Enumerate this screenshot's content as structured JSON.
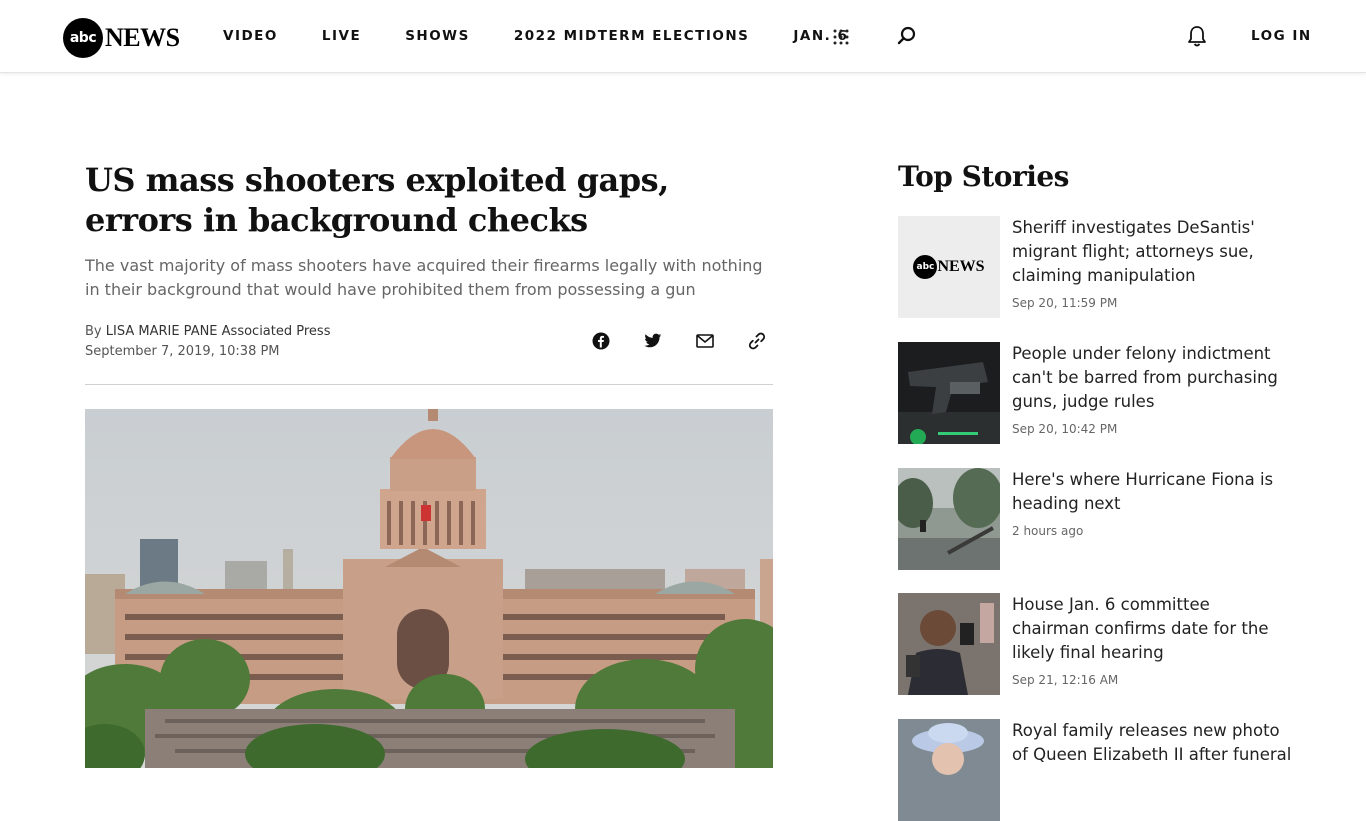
{
  "header": {
    "logo_abc": "abc",
    "logo_news": "NEWS",
    "nav": [
      "VIDEO",
      "LIVE",
      "SHOWS",
      "2022 MIDTERM ELECTIONS",
      "JAN. 6"
    ],
    "login_label": "LOG IN",
    "icons": [
      "grid-icon",
      "search-icon",
      "bell-icon"
    ]
  },
  "article": {
    "headline": "US mass shooters exploited gaps, errors in background checks",
    "dek": "The vast majority of mass shooters have acquired their firearms legally with nothing in their background that would have prohibited them from possessing a gun",
    "byline_prefix": "By",
    "author": "LISA MARIE PANE Associated Press",
    "date": "September 7, 2019, 10:38 PM",
    "share_icons": [
      "facebook-icon",
      "twitter-icon",
      "email-icon",
      "link-icon"
    ]
  },
  "sidebar": {
    "title": "Top Stories",
    "stories": [
      {
        "title": "Sheriff investigates DeSantis' migrant flight; attorneys sue, claiming manipulation",
        "time": "Sep 20, 11:59 PM",
        "thumb_abc": "abc",
        "thumb_news": "NEWS"
      },
      {
        "title": "People under felony indictment can't be barred from purchasing guns, judge rules",
        "time": "Sep 20, 10:42 PM"
      },
      {
        "title": "Here's where Hurricane Fiona is heading next",
        "time": "2 hours ago"
      },
      {
        "title": "House Jan. 6 committee chairman confirms date for the likely final hearing",
        "time": "Sep 21, 12:16 AM"
      },
      {
        "title": "Royal family releases new photo of Queen Elizabeth II after funeral",
        "time": ""
      }
    ]
  },
  "colors": {
    "text": "#111111",
    "muted": "#666666",
    "rule": "#d0d0d0"
  }
}
